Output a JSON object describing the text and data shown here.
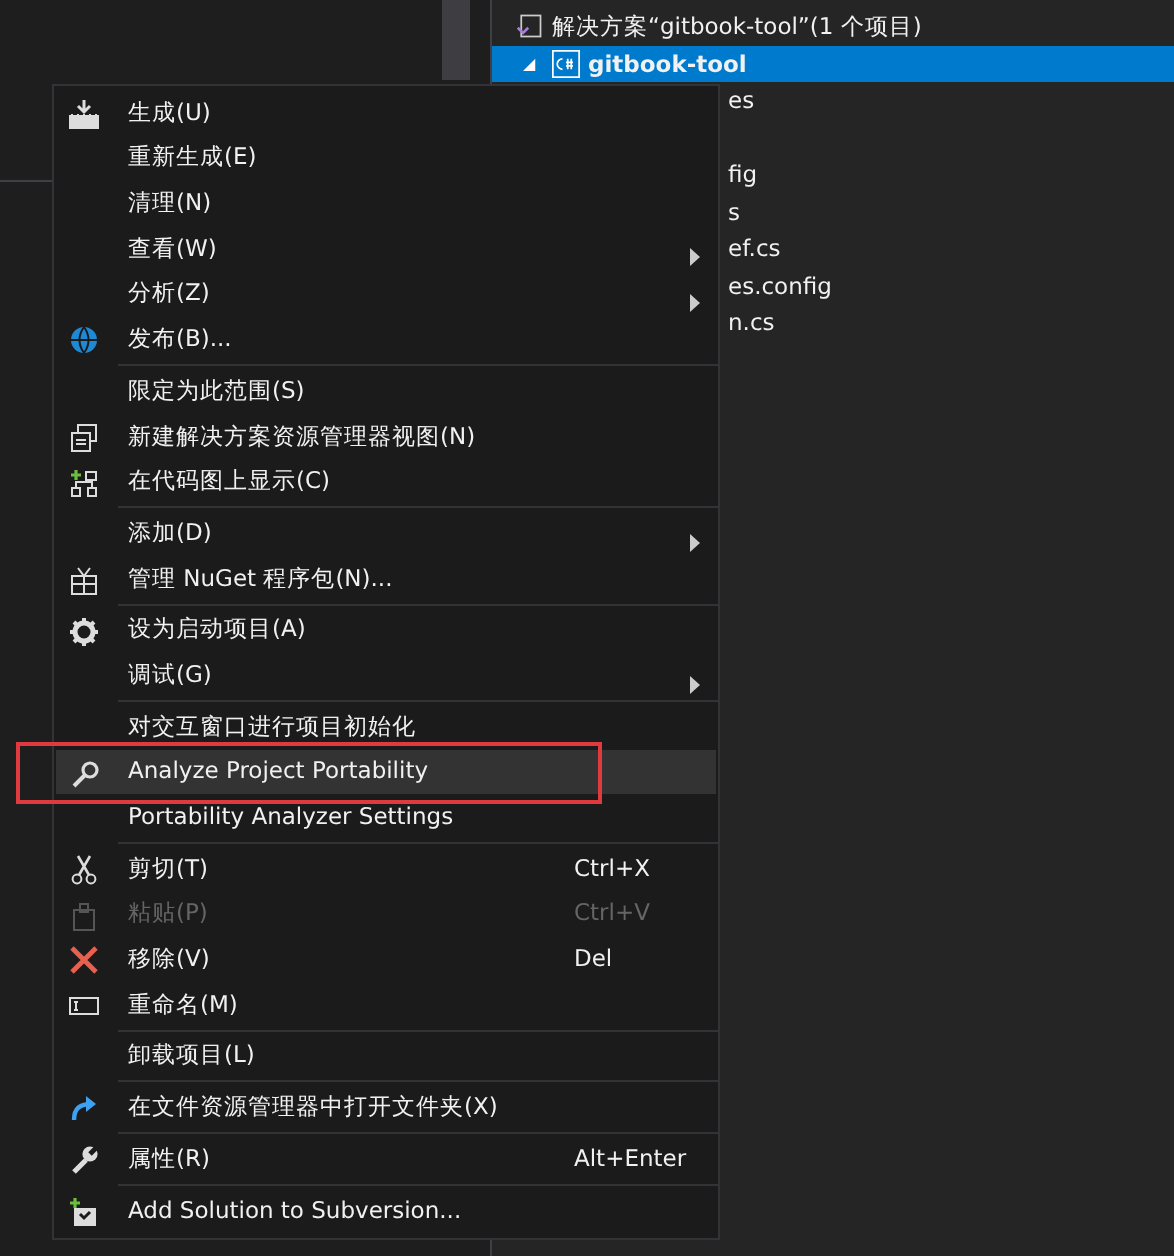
{
  "solution_explorer": {
    "solution": {
      "label": "解决方案“gitbook-tool”(1 个项目)",
      "selected": false
    },
    "project": {
      "label": "gitbook-tool",
      "selected": true,
      "expanded": true
    },
    "items": [
      {
        "label": "es",
        "selected": false
      },
      {
        "label": "fig",
        "selected": false
      },
      {
        "label": "s",
        "selected": false
      },
      {
        "label": "ef.cs",
        "selected": false
      },
      {
        "label": "es.config",
        "selected": false
      },
      {
        "label": "n.cs",
        "selected": false
      }
    ]
  },
  "context_menu": [
    {
      "kind": "item",
      "label": "生成(U)",
      "disabled": false,
      "submenu": false,
      "highlighted": false,
      "annotated": false
    },
    {
      "kind": "item",
      "label": "重新生成(E)",
      "disabled": false,
      "submenu": false,
      "highlighted": false,
      "annotated": false
    },
    {
      "kind": "item",
      "label": "清理(N)",
      "disabled": false,
      "submenu": false,
      "highlighted": false,
      "annotated": false
    },
    {
      "kind": "item",
      "label": "查看(W)",
      "disabled": false,
      "submenu": true,
      "highlighted": false,
      "annotated": false
    },
    {
      "kind": "item",
      "label": "分析(Z)",
      "disabled": false,
      "submenu": true,
      "highlighted": false,
      "annotated": false
    },
    {
      "kind": "item",
      "label": "发布(B)...",
      "disabled": false,
      "submenu": false,
      "highlighted": false,
      "annotated": false
    },
    {
      "kind": "separator"
    },
    {
      "kind": "item",
      "label": "限定为此范围(S)",
      "disabled": false,
      "submenu": false,
      "highlighted": false,
      "annotated": false
    },
    {
      "kind": "item",
      "label": "新建解决方案资源管理器视图(N)",
      "disabled": false,
      "submenu": false,
      "highlighted": false,
      "annotated": false
    },
    {
      "kind": "item",
      "label": "在代码图上显示(C)",
      "disabled": false,
      "submenu": false,
      "highlighted": false,
      "annotated": false
    },
    {
      "kind": "separator"
    },
    {
      "kind": "item",
      "label": "添加(D)",
      "disabled": false,
      "submenu": true,
      "highlighted": false,
      "annotated": false
    },
    {
      "kind": "item",
      "label": "管理 NuGet 程序包(N)...",
      "disabled": false,
      "submenu": false,
      "highlighted": false,
      "annotated": false
    },
    {
      "kind": "separator"
    },
    {
      "kind": "item",
      "label": "设为启动项目(A)",
      "disabled": false,
      "submenu": false,
      "highlighted": false,
      "annotated": false
    },
    {
      "kind": "item",
      "label": "调试(G)",
      "disabled": false,
      "submenu": true,
      "highlighted": false,
      "annotated": false
    },
    {
      "kind": "separator"
    },
    {
      "kind": "item",
      "label": "对交互窗口进行项目初始化",
      "disabled": false,
      "submenu": false,
      "highlighted": false,
      "annotated": false
    },
    {
      "kind": "item",
      "label": "Analyze Project Portability",
      "disabled": false,
      "submenu": false,
      "highlighted": true,
      "annotated": true
    },
    {
      "kind": "item",
      "label": "Portability Analyzer Settings",
      "disabled": false,
      "submenu": false,
      "highlighted": false,
      "annotated": false
    },
    {
      "kind": "separator"
    },
    {
      "kind": "item",
      "label": "剪切(T)",
      "shortcut": "Ctrl+X",
      "disabled": false,
      "submenu": false,
      "highlighted": false,
      "annotated": false
    },
    {
      "kind": "item",
      "label": "粘贴(P)",
      "shortcut": "Ctrl+V",
      "disabled": true,
      "submenu": false,
      "highlighted": false,
      "annotated": false
    },
    {
      "kind": "item",
      "label": "移除(V)",
      "shortcut": "Del",
      "disabled": false,
      "submenu": false,
      "highlighted": false,
      "annotated": false
    },
    {
      "kind": "item",
      "label": "重命名(M)",
      "disabled": false,
      "submenu": false,
      "highlighted": false,
      "annotated": false
    },
    {
      "kind": "separator"
    },
    {
      "kind": "item",
      "label": "卸载项目(L)",
      "disabled": false,
      "submenu": false,
      "highlighted": false,
      "annotated": false
    },
    {
      "kind": "separator"
    },
    {
      "kind": "item",
      "label": "在文件资源管理器中打开文件夹(X)",
      "disabled": false,
      "submenu": false,
      "highlighted": false,
      "annotated": false
    },
    {
      "kind": "separator"
    },
    {
      "kind": "item",
      "label": "属性(R)",
      "shortcut": "Alt+Enter",
      "disabled": false,
      "submenu": false,
      "highlighted": false,
      "annotated": false
    },
    {
      "kind": "separator"
    },
    {
      "kind": "item",
      "label": "Add Solution to Subversion...",
      "disabled": false,
      "submenu": false,
      "highlighted": false,
      "annotated": false
    }
  ]
}
